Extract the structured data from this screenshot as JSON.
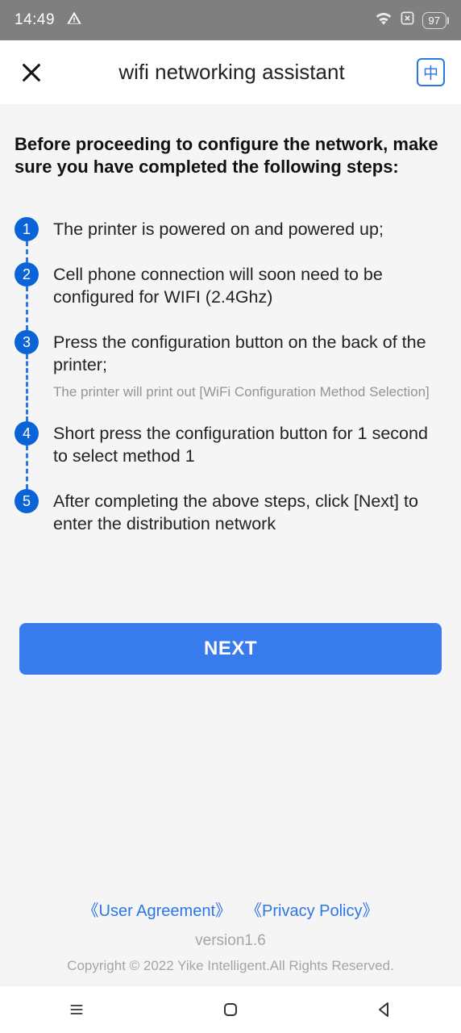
{
  "status": {
    "time": "14:49",
    "battery": "97"
  },
  "header": {
    "title": "wifi networking assistant",
    "lang": "中"
  },
  "heading": "Before proceeding to configure the network, make sure you have completed the following steps:",
  "steps": {
    "s1": {
      "text": "The printer is powered on and powered up;"
    },
    "s2": {
      "text": "Cell phone connection will soon need to be configured for WIFI (2.4Ghz)"
    },
    "s3": {
      "text": "Press the configuration button on the back of the printer;",
      "sub": "The printer will print out [WiFi Configuration Method Selection]"
    },
    "s4": {
      "text": "Short press the configuration button for 1 second to select method 1"
    },
    "s5": {
      "text": "After completing the above steps, click [Next] to enter the distribution network"
    }
  },
  "next_label": "NEXT",
  "footer": {
    "user_agreement": "《User Agreement》",
    "privacy_policy": "《Privacy Policy》",
    "version": "version1.6",
    "copyright": "Copyright © 2022 Yike Intelligent.All Rights Reserved."
  }
}
